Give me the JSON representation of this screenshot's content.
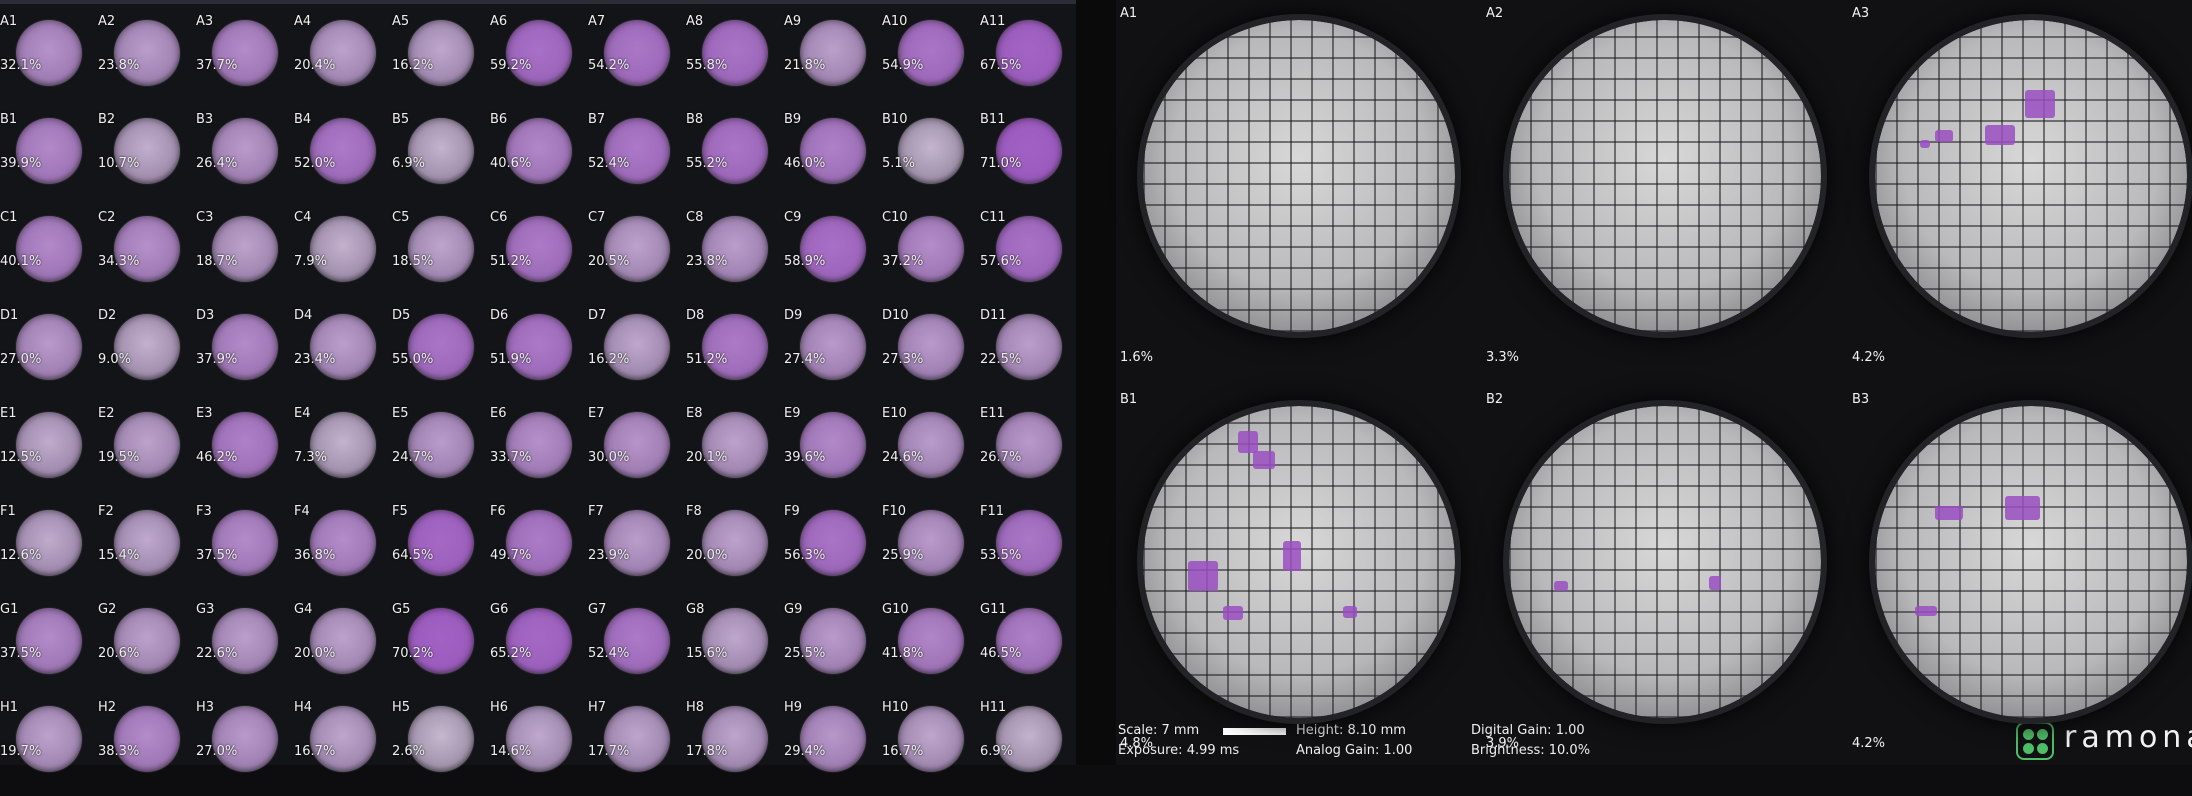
{
  "plate": {
    "rows": [
      {
        "row": "A",
        "wells": [
          {
            "id": "A1",
            "pct": "32.1%",
            "cov": 32.1
          },
          {
            "id": "A2",
            "pct": "23.8%",
            "cov": 23.8
          },
          {
            "id": "A3",
            "pct": "37.7%",
            "cov": 37.7
          },
          {
            "id": "A4",
            "pct": "20.4%",
            "cov": 20.4
          },
          {
            "id": "A5",
            "pct": "16.2%",
            "cov": 16.2
          },
          {
            "id": "A6",
            "pct": "59.2%",
            "cov": 59.2
          },
          {
            "id": "A7",
            "pct": "54.2%",
            "cov": 54.2
          },
          {
            "id": "A8",
            "pct": "55.8%",
            "cov": 55.8
          },
          {
            "id": "A9",
            "pct": "21.8%",
            "cov": 21.8
          },
          {
            "id": "A10",
            "pct": "54.9%",
            "cov": 54.9
          },
          {
            "id": "A11",
            "pct": "67.5%",
            "cov": 67.5
          }
        ]
      },
      {
        "row": "B",
        "wells": [
          {
            "id": "B1",
            "pct": "39.9%",
            "cov": 39.9
          },
          {
            "id": "B2",
            "pct": "10.7%",
            "cov": 10.7
          },
          {
            "id": "B3",
            "pct": "26.4%",
            "cov": 26.4
          },
          {
            "id": "B4",
            "pct": "52.0%",
            "cov": 52.0
          },
          {
            "id": "B5",
            "pct": "6.9%",
            "cov": 6.9
          },
          {
            "id": "B6",
            "pct": "40.6%",
            "cov": 40.6
          },
          {
            "id": "B7",
            "pct": "52.4%",
            "cov": 52.4
          },
          {
            "id": "B8",
            "pct": "55.2%",
            "cov": 55.2
          },
          {
            "id": "B9",
            "pct": "46.0%",
            "cov": 46.0
          },
          {
            "id": "B10",
            "pct": "5.1%",
            "cov": 5.1
          },
          {
            "id": "B11",
            "pct": "71.0%",
            "cov": 71.0
          }
        ]
      },
      {
        "row": "C",
        "wells": [
          {
            "id": "C1",
            "pct": "40.1%",
            "cov": 40.1
          },
          {
            "id": "C2",
            "pct": "34.3%",
            "cov": 34.3
          },
          {
            "id": "C3",
            "pct": "18.7%",
            "cov": 18.7
          },
          {
            "id": "C4",
            "pct": "7.9%",
            "cov": 7.9
          },
          {
            "id": "C5",
            "pct": "18.5%",
            "cov": 18.5
          },
          {
            "id": "C6",
            "pct": "51.2%",
            "cov": 51.2
          },
          {
            "id": "C7",
            "pct": "20.5%",
            "cov": 20.5
          },
          {
            "id": "C8",
            "pct": "23.8%",
            "cov": 23.8
          },
          {
            "id": "C9",
            "pct": "58.9%",
            "cov": 58.9
          },
          {
            "id": "C10",
            "pct": "37.2%",
            "cov": 37.2
          },
          {
            "id": "C11",
            "pct": "57.6%",
            "cov": 57.6
          }
        ]
      },
      {
        "row": "D",
        "wells": [
          {
            "id": "D1",
            "pct": "27.0%",
            "cov": 27.0
          },
          {
            "id": "D2",
            "pct": "9.0%",
            "cov": 9.0
          },
          {
            "id": "D3",
            "pct": "37.9%",
            "cov": 37.9
          },
          {
            "id": "D4",
            "pct": "23.4%",
            "cov": 23.4
          },
          {
            "id": "D5",
            "pct": "55.0%",
            "cov": 55.0
          },
          {
            "id": "D6",
            "pct": "51.9%",
            "cov": 51.9
          },
          {
            "id": "D7",
            "pct": "16.2%",
            "cov": 16.2
          },
          {
            "id": "D8",
            "pct": "51.2%",
            "cov": 51.2
          },
          {
            "id": "D9",
            "pct": "27.4%",
            "cov": 27.4
          },
          {
            "id": "D10",
            "pct": "27.3%",
            "cov": 27.3
          },
          {
            "id": "D11",
            "pct": "22.5%",
            "cov": 22.5
          }
        ]
      },
      {
        "row": "E",
        "wells": [
          {
            "id": "E1",
            "pct": "12.5%",
            "cov": 12.5
          },
          {
            "id": "E2",
            "pct": "19.5%",
            "cov": 19.5
          },
          {
            "id": "E3",
            "pct": "46.2%",
            "cov": 46.2
          },
          {
            "id": "E4",
            "pct": "7.3%",
            "cov": 7.3
          },
          {
            "id": "E5",
            "pct": "24.7%",
            "cov": 24.7
          },
          {
            "id": "E6",
            "pct": "33.7%",
            "cov": 33.7
          },
          {
            "id": "E7",
            "pct": "30.0%",
            "cov": 30.0
          },
          {
            "id": "E8",
            "pct": "20.1%",
            "cov": 20.1
          },
          {
            "id": "E9",
            "pct": "39.6%",
            "cov": 39.6
          },
          {
            "id": "E10",
            "pct": "24.6%",
            "cov": 24.6
          },
          {
            "id": "E11",
            "pct": "26.7%",
            "cov": 26.7
          }
        ]
      },
      {
        "row": "F",
        "wells": [
          {
            "id": "F1",
            "pct": "12.6%",
            "cov": 12.6
          },
          {
            "id": "F2",
            "pct": "15.4%",
            "cov": 15.4
          },
          {
            "id": "F3",
            "pct": "37.5%",
            "cov": 37.5
          },
          {
            "id": "F4",
            "pct": "36.8%",
            "cov": 36.8
          },
          {
            "id": "F5",
            "pct": "64.5%",
            "cov": 64.5
          },
          {
            "id": "F6",
            "pct": "49.7%",
            "cov": 49.7
          },
          {
            "id": "F7",
            "pct": "23.9%",
            "cov": 23.9
          },
          {
            "id": "F8",
            "pct": "20.0%",
            "cov": 20.0
          },
          {
            "id": "F9",
            "pct": "56.3%",
            "cov": 56.3
          },
          {
            "id": "F10",
            "pct": "25.9%",
            "cov": 25.9
          },
          {
            "id": "F11",
            "pct": "53.5%",
            "cov": 53.5
          }
        ]
      },
      {
        "row": "G",
        "wells": [
          {
            "id": "G1",
            "pct": "37.5%",
            "cov": 37.5
          },
          {
            "id": "G2",
            "pct": "20.6%",
            "cov": 20.6
          },
          {
            "id": "G3",
            "pct": "22.6%",
            "cov": 22.6
          },
          {
            "id": "G4",
            "pct": "20.0%",
            "cov": 20.0
          },
          {
            "id": "G5",
            "pct": "70.2%",
            "cov": 70.2
          },
          {
            "id": "G6",
            "pct": "65.2%",
            "cov": 65.2
          },
          {
            "id": "G7",
            "pct": "52.4%",
            "cov": 52.4
          },
          {
            "id": "G8",
            "pct": "15.6%",
            "cov": 15.6
          },
          {
            "id": "G9",
            "pct": "25.5%",
            "cov": 25.5
          },
          {
            "id": "G10",
            "pct": "41.8%",
            "cov": 41.8
          },
          {
            "id": "G11",
            "pct": "46.5%",
            "cov": 46.5
          }
        ]
      },
      {
        "row": "H",
        "wells": [
          {
            "id": "H1",
            "pct": "19.7%",
            "cov": 19.7
          },
          {
            "id": "H2",
            "pct": "38.3%",
            "cov": 38.3
          },
          {
            "id": "H3",
            "pct": "27.0%",
            "cov": 27.0
          },
          {
            "id": "H4",
            "pct": "16.7%",
            "cov": 16.7
          },
          {
            "id": "H5",
            "pct": "2.6%",
            "cov": 2.6
          },
          {
            "id": "H6",
            "pct": "14.6%",
            "cov": 14.6
          },
          {
            "id": "H7",
            "pct": "17.7%",
            "cov": 17.7
          },
          {
            "id": "H8",
            "pct": "17.8%",
            "cov": 17.8
          },
          {
            "id": "H9",
            "pct": "29.4%",
            "cov": 29.4
          },
          {
            "id": "H10",
            "pct": "16.7%",
            "cov": 16.7
          },
          {
            "id": "H11",
            "pct": "6.9%",
            "cov": 6.9
          }
        ]
      }
    ]
  },
  "detail": {
    "wells": [
      {
        "id": "A1",
        "pct": "1.6%"
      },
      {
        "id": "A2",
        "pct": "3.3%"
      },
      {
        "id": "A3",
        "pct": "4.2%"
      },
      {
        "id": "B1",
        "pct": "4.8%"
      },
      {
        "id": "B2",
        "pct": "3.9%"
      },
      {
        "id": "B3",
        "pct": "4.2%"
      }
    ]
  },
  "footer": {
    "scale": "Scale: 7 mm",
    "exposure": "Exposure: 4.99 ms",
    "height": "Height: 8.10 mm",
    "analog_gain": "Analog Gain: 1.00",
    "digital_gain": "Digital Gain: 1.00",
    "brightness": "Brightness: 10.0%"
  },
  "brand": {
    "name": "ramona",
    "logo_icon": "four-dots-logo-icon",
    "logo_color": "#4fbf68"
  },
  "colors": {
    "stain": "#9a4fc2",
    "disk_base": "#b9b9bb",
    "background": "#131417"
  }
}
